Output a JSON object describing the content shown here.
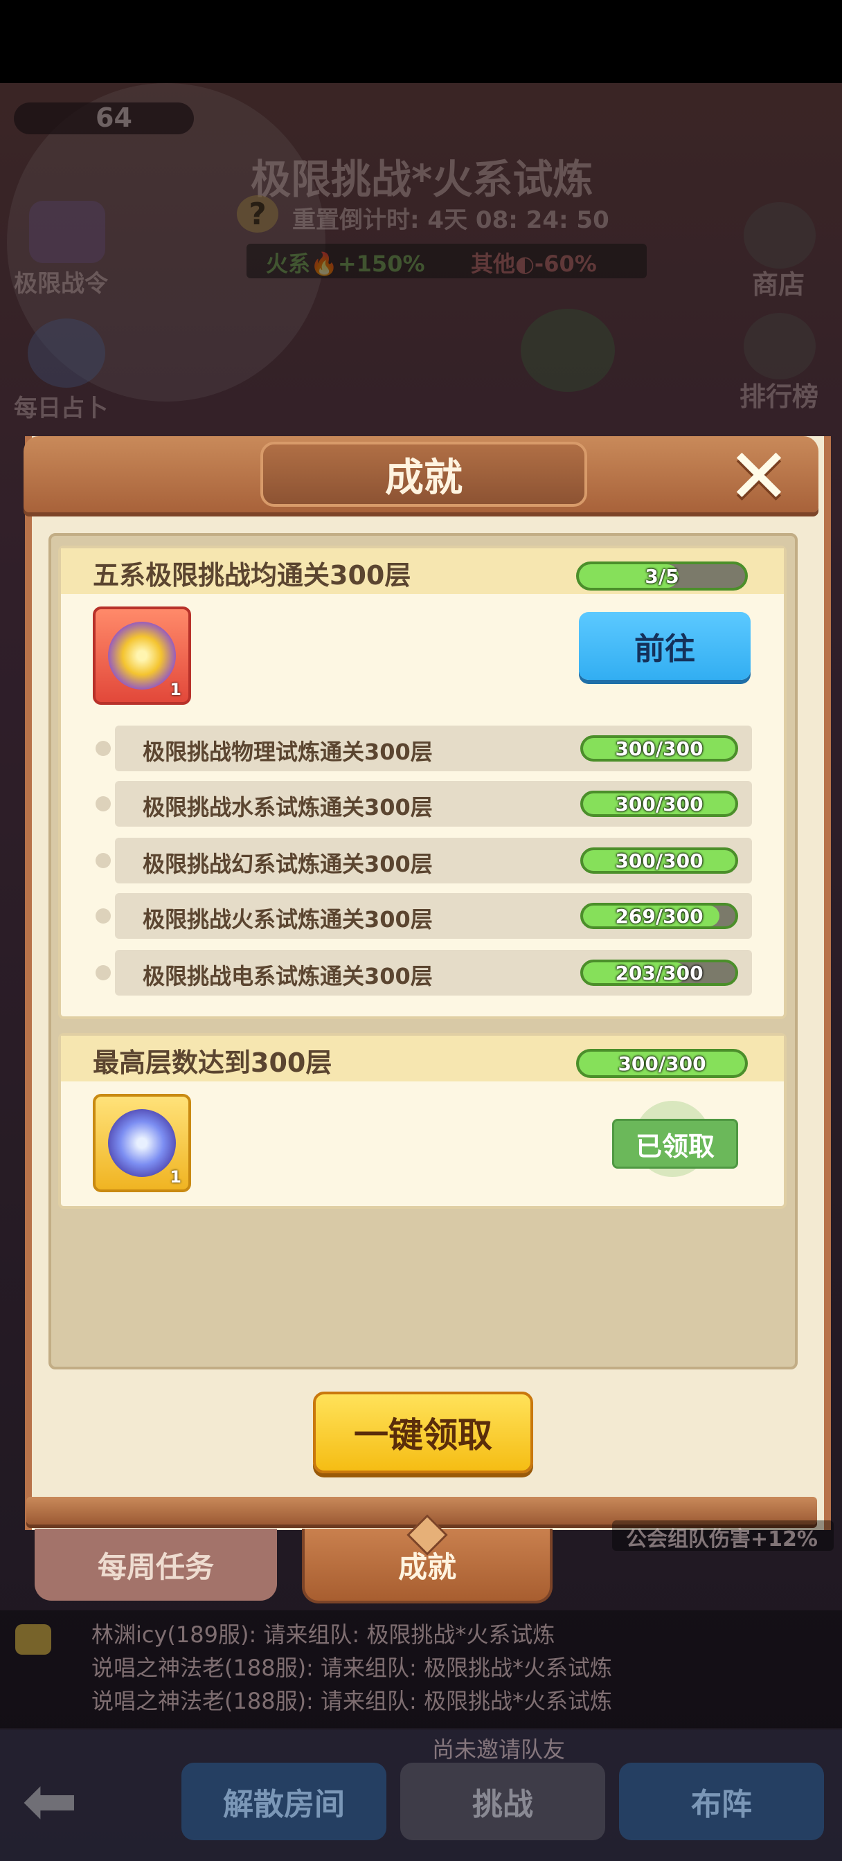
{
  "background": {
    "level": "64",
    "stage_title": "极限挑战*火系试炼",
    "reset_label": "重置倒计时: 4天 08: 24: 50",
    "buff_fire": "火系🔥+150%",
    "buff_other": "其他◐-60%",
    "left_menu": [
      "极限战令",
      "每日占卜"
    ],
    "right_menu": [
      "商店",
      "排行榜"
    ],
    "guild_bonus": "公会组队伤害+12%",
    "chat": [
      "林渊icy(189服): 请来组队: 极限挑战*火系试炼",
      "说唱之神法老(188服): 请来组队: 极限挑战*火系试炼",
      "说唱之神法老(188服): 请来组队: 极限挑战*火系试炼"
    ],
    "invite_status": "尚未邀请队友",
    "bottom_buttons": [
      "解散房间",
      "挑战",
      "布阵"
    ]
  },
  "modal": {
    "title": "成就",
    "groups": [
      {
        "title": "五系极限挑战均通关300层",
        "progress_text": "3/5",
        "progress_ratio": 0.6,
        "reward_qty": "1",
        "action_label": "前往",
        "subtasks": [
          {
            "label": "极限挑战物理试炼通关300层",
            "progress_text": "300/300",
            "ratio": 1.0
          },
          {
            "label": "极限挑战水系试炼通关300层",
            "progress_text": "300/300",
            "ratio": 1.0
          },
          {
            "label": "极限挑战幻系试炼通关300层",
            "progress_text": "300/300",
            "ratio": 1.0
          },
          {
            "label": "极限挑战火系试炼通关300层",
            "progress_text": "269/300",
            "ratio": 0.8967
          },
          {
            "label": "极限挑战电系试炼通关300层",
            "progress_text": "203/300",
            "ratio": 0.6767
          }
        ]
      },
      {
        "title": "最高层数达到300层",
        "progress_text": "300/300",
        "progress_ratio": 1.0,
        "reward_qty": "1",
        "status_label": "已领取"
      }
    ],
    "claim_all_label": "一键领取",
    "tabs": [
      "每周任务",
      "成就"
    ]
  },
  "colors": {
    "progress_fill": "#86e05a",
    "goto_button": "#32aef2",
    "claim_button": "#f5bd14",
    "frame_brown": "#b8734a"
  }
}
